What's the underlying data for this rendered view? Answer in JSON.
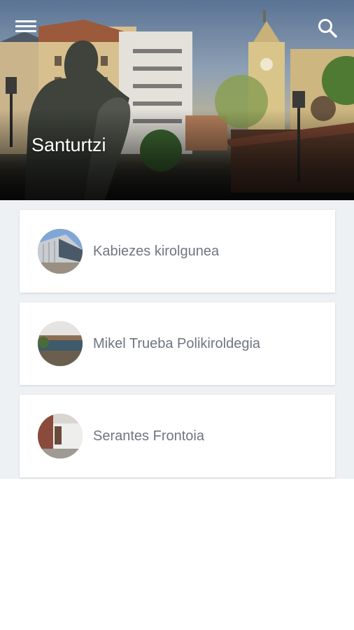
{
  "header": {
    "title": "Santurtzi",
    "menu_icon": "hamburger-menu-icon",
    "search_icon": "search-icon"
  },
  "facilities": [
    {
      "label": "Kabiezes kirolgunea",
      "thumbnail": "facility-photo"
    },
    {
      "label": "Mikel Trueba Polikiroldegia",
      "thumbnail": "facility-photo"
    },
    {
      "label": "Serantes Frontoia",
      "thumbnail": "facility-photo"
    }
  ],
  "colors": {
    "list_background": "#eef1f4",
    "card_background": "#ffffff",
    "label_text": "#6e7681",
    "title_text": "#ffffff"
  }
}
